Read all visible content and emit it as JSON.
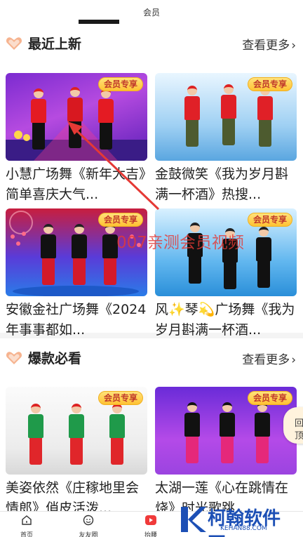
{
  "header": {
    "title": "会员"
  },
  "sections": [
    {
      "title": "最近上新",
      "more_label": "查看更多",
      "items": [
        {
          "badge": "会员专享",
          "title": "小慧广场舞《新年大吉》简单喜庆大气..."
        },
        {
          "badge": "会员专享",
          "title": "金鼓微笑《我为岁月斟满一杯酒》热搜..."
        },
        {
          "badge": "会员专享",
          "title": "安徽金社广场舞《2024年事事都如..."
        },
        {
          "badge": "会员专享",
          "title": "风✨琴💫广场舞《我为岁月斟满一杯酒..."
        }
      ]
    },
    {
      "title": "爆款必看",
      "more_label": "查看更多",
      "items": [
        {
          "badge": "会员专享",
          "title": "美姿依然《庄稼地里会情郎》俏皮活泼..."
        },
        {
          "badge": "会员专享",
          "title": "太湖一莲《心在跳情在烧》时光歌跳..."
        }
      ]
    }
  ],
  "overlay_caption": "007亲测会员视频",
  "side_button": {
    "line1": "回",
    "line2": "顶"
  },
  "tabbar": {
    "items": [
      {
        "label": "首页",
        "icon": "home-icon"
      },
      {
        "label": "友友圈",
        "icon": "smile-icon"
      },
      {
        "label": "抬腰",
        "icon": "play-icon"
      }
    ]
  },
  "watermark": {
    "name": "柯翰软件园",
    "url": "KEHAN88.COM"
  },
  "colors": {
    "accent": "#e53935",
    "badge_bg": "#ffc233",
    "brand_blue": "#1c4fb5"
  }
}
